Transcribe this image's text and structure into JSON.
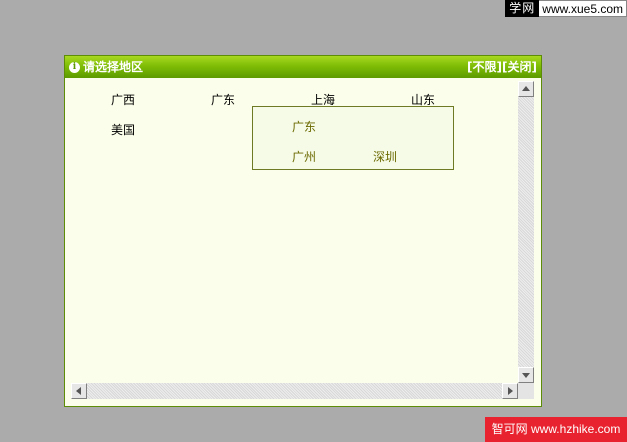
{
  "watermark_top": {
    "site_name": "学网",
    "url": "www.xue5.com"
  },
  "watermark_bottom": {
    "text": "智可网 www.hzhike.com"
  },
  "dialog": {
    "title": "请选择地区",
    "action_unlimited": "[不限]",
    "action_close": "[关闭]",
    "regions": [
      {
        "label": "广西"
      },
      {
        "label": "广东"
      },
      {
        "label": "上海"
      },
      {
        "label": "山东"
      },
      {
        "label": "美国"
      }
    ],
    "popup": {
      "province": "广东",
      "cities": [
        {
          "label": "广州"
        },
        {
          "label": "深圳"
        }
      ]
    }
  },
  "colors": {
    "titlebar": "#7fbd06",
    "dialog_bg": "#fbfeea",
    "popup_border": "#6e7a24",
    "popup_text": "#6b6a00",
    "page_bg": "#ababab"
  },
  "icons": {
    "title_icon": "info-icon",
    "scroll_up": "arrow-up-icon",
    "scroll_down": "arrow-down-icon",
    "scroll_left": "arrow-left-icon",
    "scroll_right": "arrow-right-icon"
  }
}
